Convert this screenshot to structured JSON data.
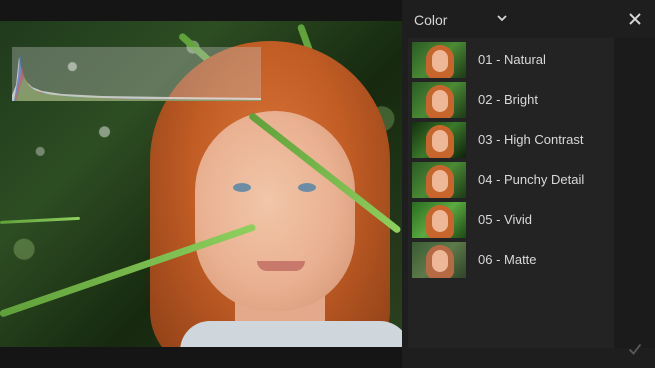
{
  "panel": {
    "category_label": "Color",
    "presets": [
      {
        "label": "01 - Natural"
      },
      {
        "label": "02 - Bright"
      },
      {
        "label": "03 - High Contrast"
      },
      {
        "label": "04 - Punchy Detail"
      },
      {
        "label": "05 - Vivid"
      },
      {
        "label": "06 - Matte"
      }
    ]
  },
  "icons": {
    "dropdown": "chevron-down-icon",
    "close": "close-icon",
    "confirm": "checkmark-icon"
  },
  "colors": {
    "panel_bg": "#1e1e1e",
    "list_bg": "#232323",
    "text": "#d9d9d9",
    "confirm_disabled": "#5a5a5a"
  }
}
